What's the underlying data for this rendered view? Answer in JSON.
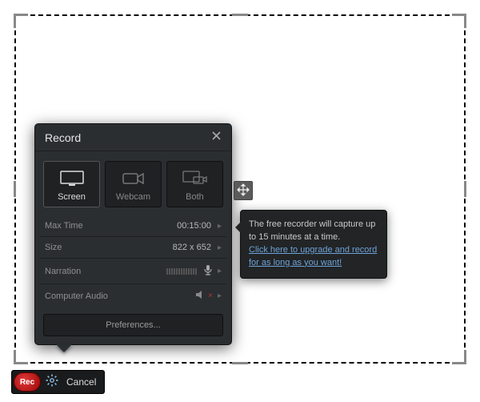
{
  "panel": {
    "title": "Record",
    "modes": {
      "screen": "Screen",
      "webcam": "Webcam",
      "both": "Both"
    },
    "rows": {
      "maxtime_label": "Max Time",
      "maxtime_value": "00:15:00",
      "size_label": "Size",
      "size_value": "822 x 652",
      "narration_label": "Narration",
      "compaudio_label": "Computer Audio"
    },
    "preferences": "Preferences..."
  },
  "tooltip": {
    "text": "The free recorder will capture up to 15 minutes at a time.",
    "link": "Click here to upgrade and record for as long as you want!"
  },
  "toolbar": {
    "rec": "Rec",
    "cancel": "Cancel"
  },
  "icons": {
    "close": "close-icon",
    "move": "move-icon",
    "screen": "monitor-icon",
    "webcam": "webcam-icon",
    "both": "both-icon",
    "mic": "microphone-icon",
    "speaker": "speaker-icon",
    "gear": "gear-icon",
    "chevron": "chevron-right-icon"
  }
}
